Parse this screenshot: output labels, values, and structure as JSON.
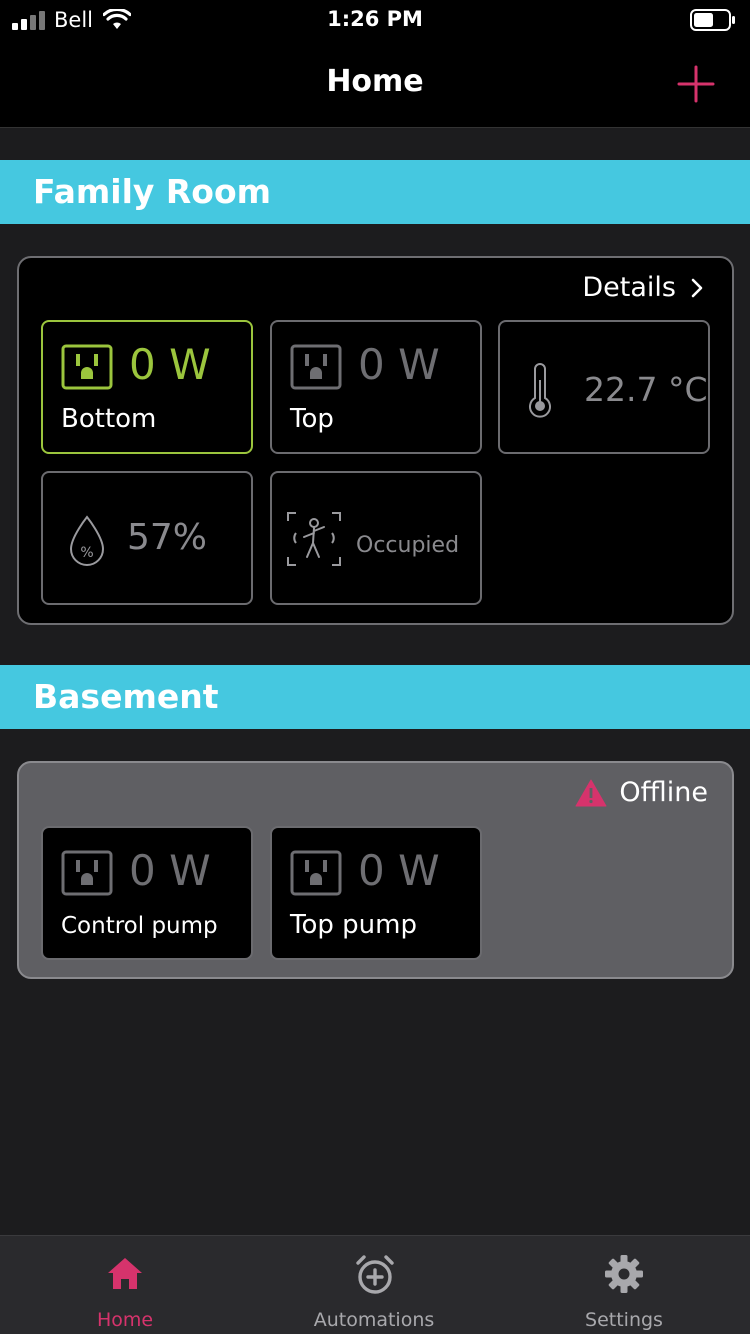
{
  "status_bar": {
    "carrier": "Bell",
    "time": "1:26 PM",
    "signal_icon": "signal-bars-icon",
    "wifi_icon": "wifi-icon",
    "battery_icon": "battery-icon"
  },
  "header": {
    "title": "Home",
    "add_icon": "plus-icon"
  },
  "rooms": [
    {
      "name": "Family Room",
      "link_label": "Details",
      "devices": [
        {
          "type": "outlet",
          "power": "0 W",
          "label": "Bottom",
          "active": true
        },
        {
          "type": "outlet",
          "power": "0 W",
          "label": "Top",
          "active": false
        },
        {
          "type": "temperature",
          "value": "22.7 °C",
          "icon": "thermometer-icon"
        },
        {
          "type": "humidity",
          "value": "57%",
          "icon": "humidity-drop-icon"
        },
        {
          "type": "motion",
          "value": "Occupied",
          "icon": "motion-sensor-icon"
        }
      ]
    },
    {
      "name": "Basement",
      "status_label": "Offline",
      "status_icon": "warning-triangle-icon",
      "devices": [
        {
          "type": "outlet",
          "power": "0 W",
          "label": "Control pump",
          "active": false
        },
        {
          "type": "outlet",
          "power": "0 W",
          "label": "Top pump",
          "active": false
        }
      ]
    }
  ],
  "tab_bar": {
    "items": [
      {
        "label": "Home",
        "icon": "home-icon",
        "selected": true
      },
      {
        "label": "Automations",
        "icon": "alarm-clock-plus-icon",
        "selected": false
      },
      {
        "label": "Settings",
        "icon": "gear-icon",
        "selected": false
      }
    ]
  },
  "colors": {
    "accent": "#d6336c",
    "section_header": "#45c8e0",
    "active_green": "#9bc53d",
    "offline_card": "#5f5f63"
  }
}
